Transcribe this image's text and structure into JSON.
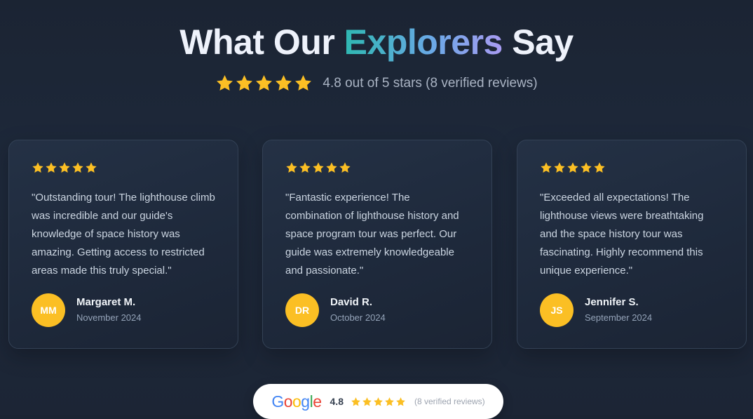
{
  "heading": {
    "prefix": "What Our ",
    "accent": "Explorers",
    "suffix": " Say"
  },
  "summary": {
    "stars": 5,
    "text": "4.8 out of 5 stars (8 verified reviews)"
  },
  "colors": {
    "star": "#fbbf24",
    "avatar": "#fbbf24",
    "card_border": "#334155",
    "background": "#1e293b",
    "accent_gradient": [
      "#2fb8b2",
      "#6aa9e6",
      "#a99bf2"
    ]
  },
  "reviews": [
    {
      "stars": 5,
      "quote": "\"Outstanding tour! The lighthouse climb was incredible and our guide's knowledge of space history was amazing. Getting access to restricted areas made this truly special.\"",
      "initials": "MM",
      "name": "Margaret M.",
      "date": "November 2024"
    },
    {
      "stars": 5,
      "quote": "\"Fantastic experience! The combination of lighthouse history and space program tour was perfect. Our guide was extremely knowledgeable and passionate.\"",
      "initials": "DR",
      "name": "David R.",
      "date": "October 2024"
    },
    {
      "stars": 5,
      "quote": "\"Exceeded all expectations! The lighthouse views were breathtaking and the space history tour was fascinating. Highly recommend this unique experience.\"",
      "initials": "JS",
      "name": "Jennifer S.",
      "date": "September 2024"
    }
  ],
  "google_badge": {
    "logo_letters": [
      "G",
      "o",
      "o",
      "g",
      "l",
      "e"
    ],
    "rating": "4.8",
    "stars": 5,
    "count": "(8 verified reviews)"
  },
  "icons": {
    "star": "star-icon"
  }
}
